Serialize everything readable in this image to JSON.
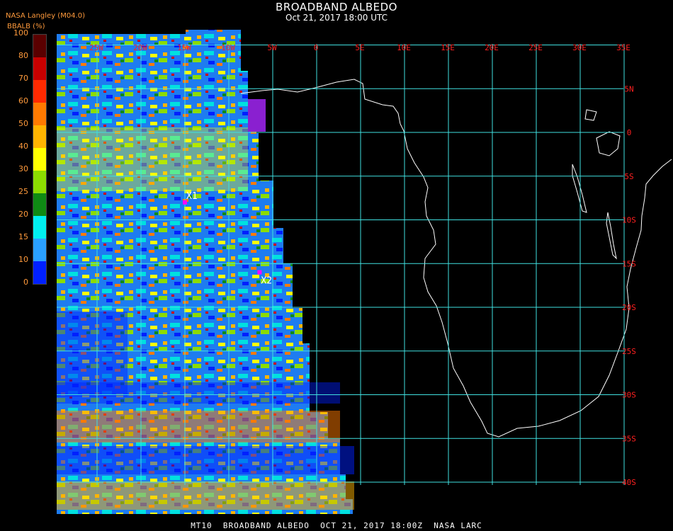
{
  "header": {
    "title": "BROADBAND ALBEDO",
    "subtitle": "Oct 21, 2017 18:00 UTC",
    "source": "NASA Langley (M04.0)",
    "units": "BBALB (%)"
  },
  "colorbar": {
    "ticks": [
      "100",
      "80",
      "70",
      "60",
      "50",
      "40",
      "30",
      "25",
      "20",
      "15",
      "10",
      "0"
    ],
    "colors": [
      "#5a0000",
      "#c80000",
      "#ff2a00",
      "#ff7a00",
      "#ffb400",
      "#ffff00",
      "#8cdc00",
      "#0f8a14",
      "#00f0f0",
      "#2aa0ff",
      "#0020ff",
      "#8a20d0"
    ]
  },
  "map": {
    "lon_labels": [
      "25W",
      "20W",
      "15W",
      "10W",
      "5W",
      "0",
      "5E",
      "10E",
      "15E",
      "20E",
      "25E",
      "30E",
      "35E"
    ],
    "lat_labels": [
      "5N",
      "0",
      "5S",
      "10S",
      "15S",
      "20S",
      "25S",
      "30S",
      "35S",
      "40S"
    ],
    "markers": [
      {
        "label": "X1",
        "lon": -15,
        "lat": -8
      },
      {
        "label": "X2",
        "lon": -6.5,
        "lat": -16
      }
    ],
    "grid_color": "#40e0e0",
    "label_color": "#ff2020"
  },
  "footer": "MT10  BROADBAND ALBEDO  OCT 21, 2017 18:00Z  NASA LARC"
}
